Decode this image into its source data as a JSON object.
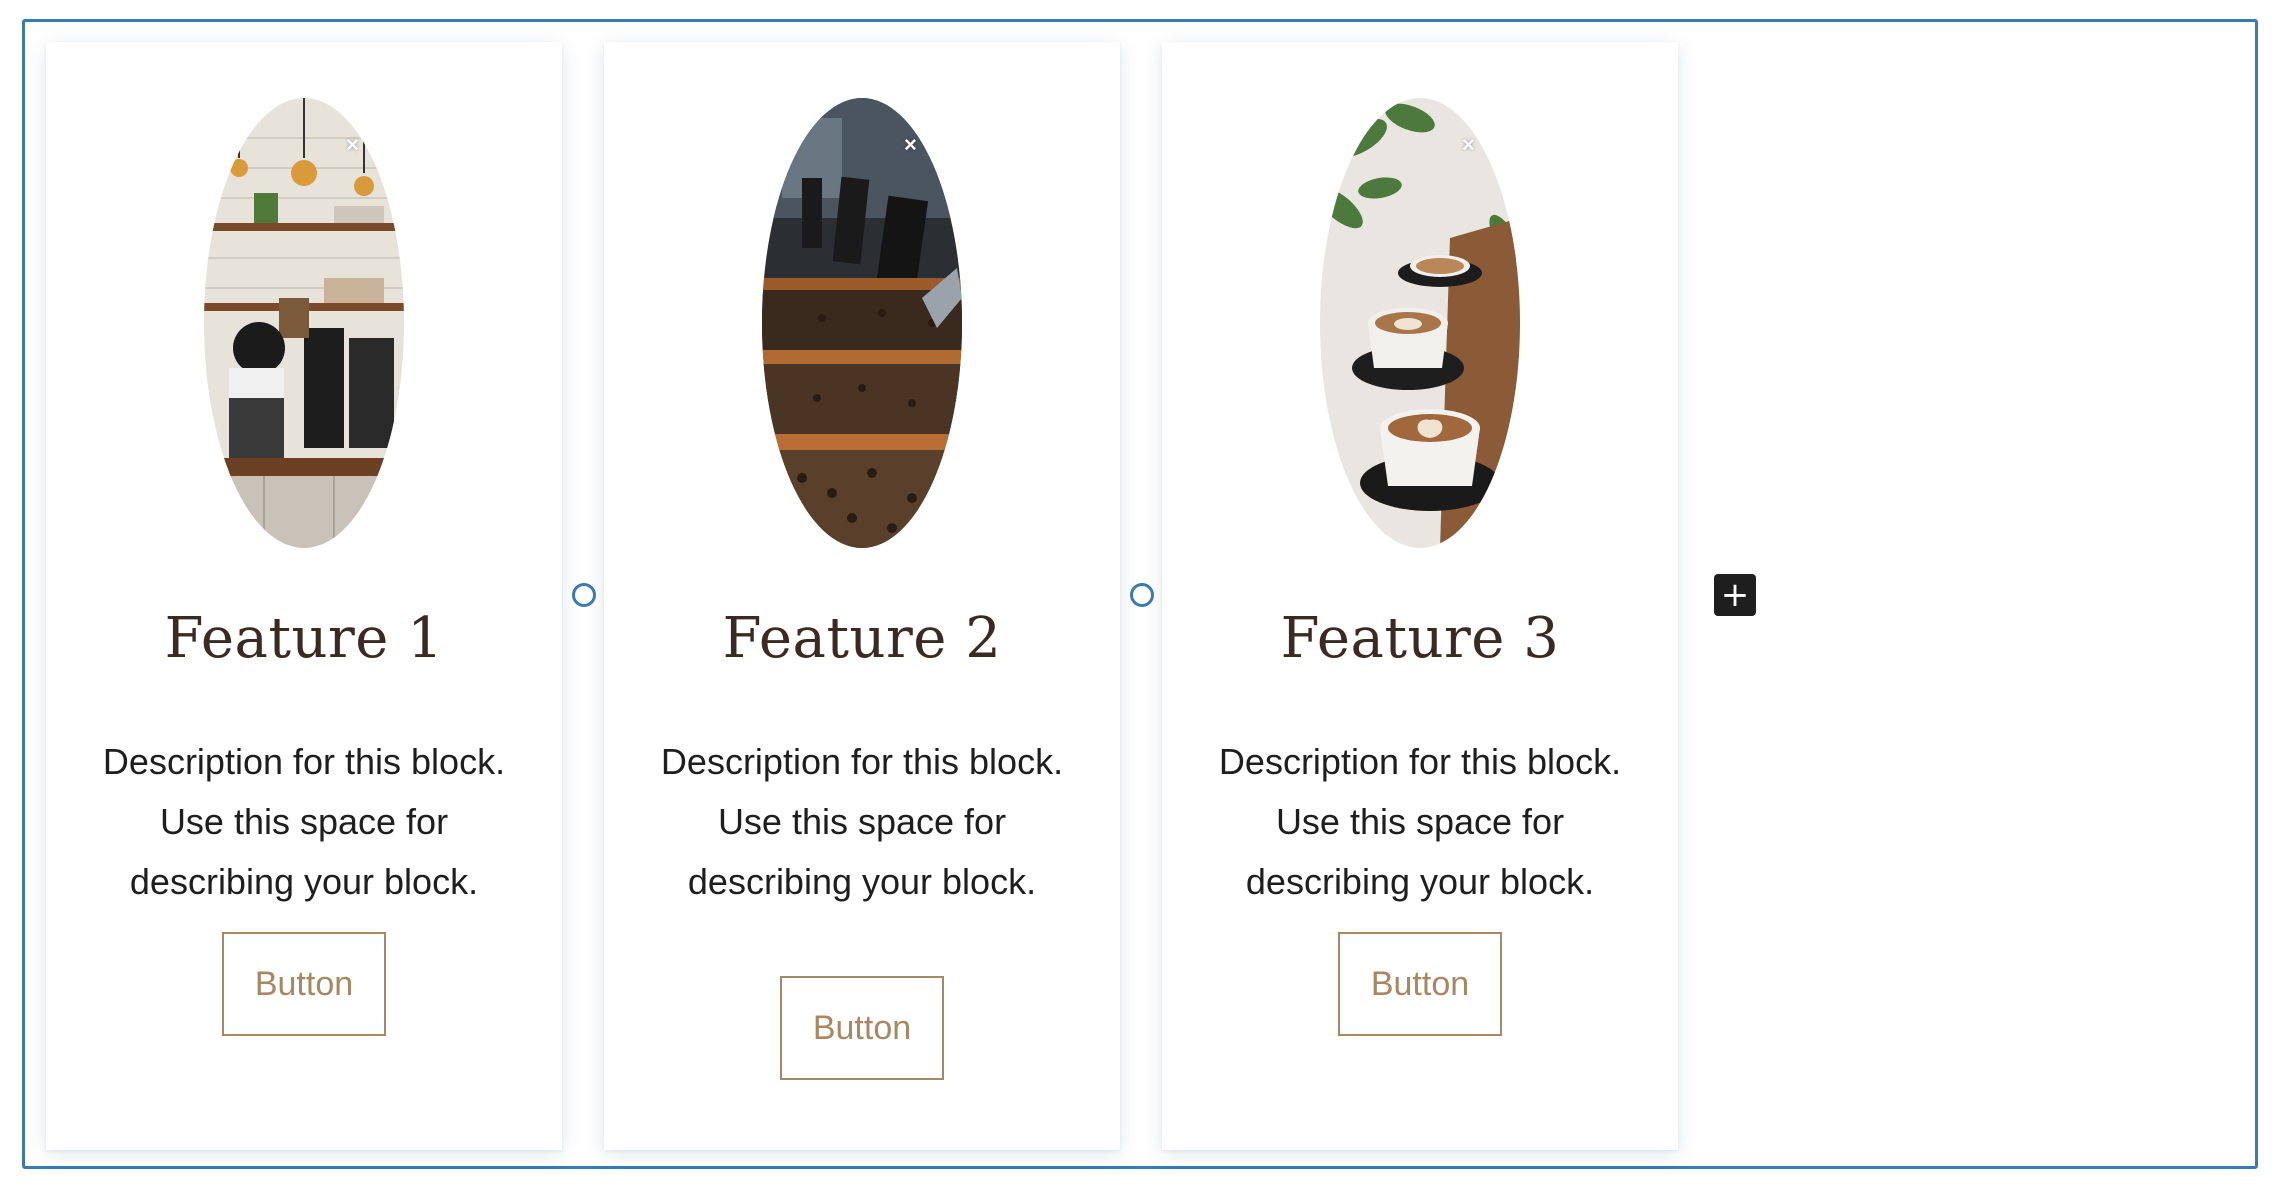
{
  "features": [
    {
      "title": "Feature 1",
      "description": "Description for this block. Use this space for describing your block.",
      "button_label": "Button",
      "image_alt": "coffee shop counter with barista"
    },
    {
      "title": "Feature 2",
      "description": "Description for this block. Use this space for describing your block.",
      "button_label": "Button",
      "image_alt": "coffee bean trays"
    },
    {
      "title": "Feature 3",
      "description": "Description for this block. Use this space for describing your block.",
      "button_label": "Button",
      "image_alt": "latte art cups"
    }
  ],
  "icons": {
    "close": "×",
    "add": "+"
  },
  "colors": {
    "selection_border": "#3a7bb0",
    "button_accent": "#a88862",
    "heading": "#3b2a21",
    "inserter_bg": "#1e1e1e"
  }
}
